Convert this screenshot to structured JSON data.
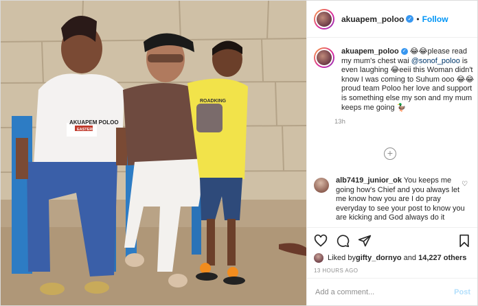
{
  "header": {
    "username": "akuapem_poloo",
    "follow_label": "Follow",
    "dot": "•"
  },
  "caption": {
    "username": "akuapem_poloo",
    "text_1": " 😂😂please read my mum's chest wai ",
    "mention": "@sonof_poloo",
    "text_2": " is even laughing 😂eeii this Woman didn't know I was coming to Suhum ooo 😂😂 proud team Poloo her love and support is something else my son and my mum keeps me going 🦆",
    "time": "13h"
  },
  "load_more_icon": "plus-circle-icon",
  "comment": {
    "username": "alb7419_junior_ok",
    "text": " You keeps me going how's Chief and you always let me know how you are I do pray everyday to see your post to know you are kicking and God always do it"
  },
  "likes": {
    "prefix": "Liked by ",
    "user": "gifty_dornyo",
    "middle": " and ",
    "count": "14,227 others"
  },
  "timestamp": "13 HOURS AGO",
  "add_comment": {
    "placeholder": "Add a comment...",
    "post_label": "Post"
  },
  "photo": {
    "shirt_text_1": "AKUAPEM POLOO",
    "shirt_text_2": "EASTERN",
    "boy_shirt_text": "ROADKING"
  },
  "colors": {
    "accent": "#0095f6",
    "post_disabled": "#b2dffc",
    "verified": "#3897f0"
  }
}
